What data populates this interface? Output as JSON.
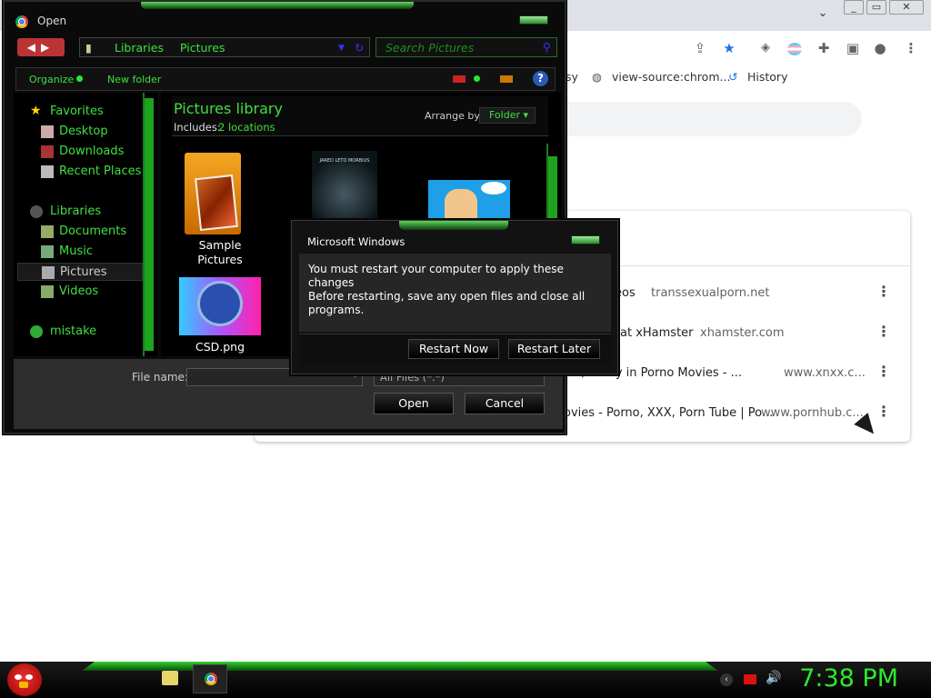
{
  "chrome": {
    "bookmarks": [
      "sy",
      "view-source:chrom...",
      "History"
    ],
    "history_rows": [
      {
        "title": "eos",
        "domain": "transsexualporn.net"
      },
      {
        "title": "at xHamster",
        "domain": "xhamster.com"
      },
      {
        "title": "...s, Pussy in Porno Movies - ...",
        "domain": "www.xnxx.c..."
      },
      {
        "title": "ovies - Porno, XXX, Porn Tube | Po...",
        "domain": "www.pornhub.c..."
      }
    ],
    "more_icon": "⋮",
    "controls": {
      "minimize": "⌄",
      "restore": "▭",
      "close": "✕"
    }
  },
  "open_dialog": {
    "title": "Open",
    "address": {
      "crumb1": "Libraries",
      "crumb2": "Pictures"
    },
    "search_placeholder": "Search Pictures",
    "command_bar": {
      "organize": "Organize",
      "new_folder": "New folder"
    },
    "nav": {
      "favorites": "Favorites",
      "desktop": "Desktop",
      "downloads": "Downloads",
      "recent": "Recent Places",
      "libraries": "Libraries",
      "documents": "Documents",
      "music": "Music",
      "pictures": "Pictures",
      "videos": "Videos",
      "mistake": "mistake"
    },
    "library": {
      "title": "Pictures library",
      "includes_label": "Includes:",
      "includes_value": "2 locations",
      "arrange_label": "Arrange by:",
      "arrange_value": "Folder"
    },
    "items": {
      "sample_pictures": "Sample Pictures",
      "csd": "CSD.png",
      "poster_caption": "JARED LETO MORBIUS"
    },
    "file_name_label": "File name:",
    "file_type": "All Files (*.*)",
    "open_label": "Open",
    "cancel_label": "Cancel"
  },
  "msgbox": {
    "title": "Microsoft Windows",
    "line1": "You must restart your computer to apply these changes",
    "line2": "Before restarting, save any open files and close all programs.",
    "restart_now": "Restart Now",
    "restart_later": "Restart Later"
  },
  "taskbar": {
    "clock": "7:38 PM"
  }
}
